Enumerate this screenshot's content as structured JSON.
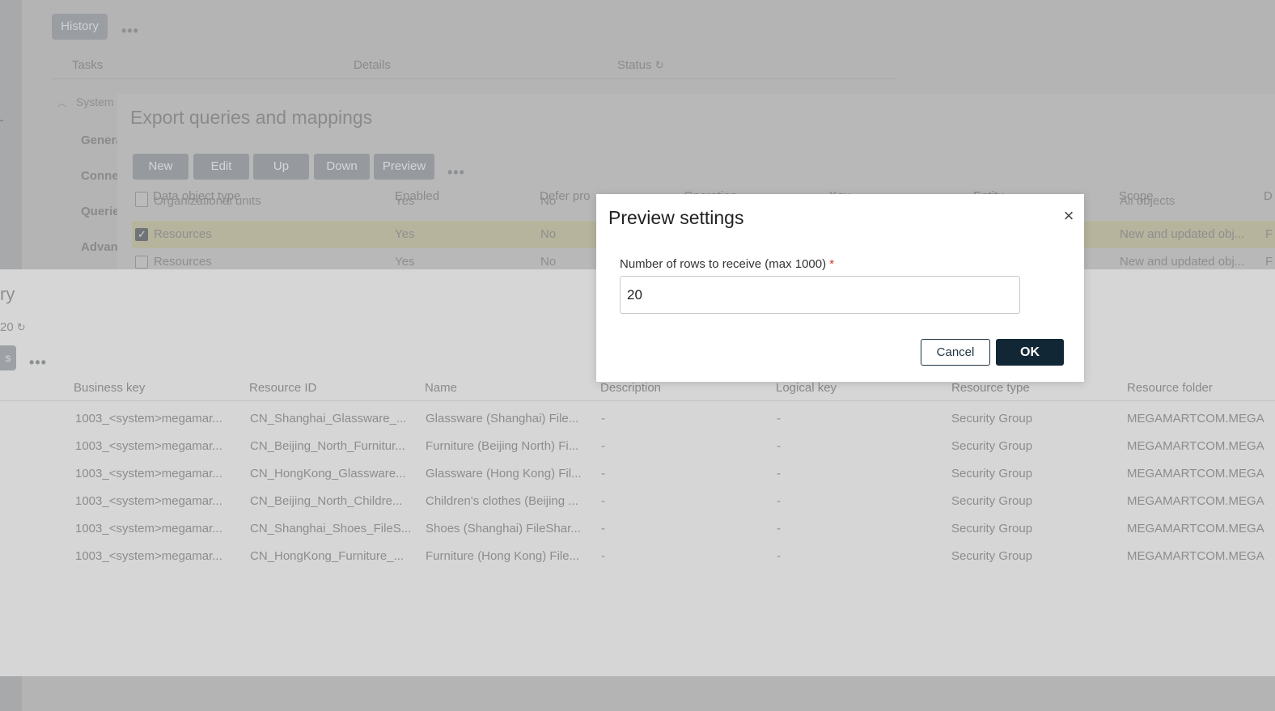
{
  "base": {
    "history_button": "History",
    "headers": {
      "tasks": "Tasks",
      "details": "Details",
      "status": "Status"
    },
    "section_label": "System",
    "sidebar_items": [
      "General",
      "Connection",
      "Queries",
      "Advanced"
    ]
  },
  "export_panel": {
    "title": "Export queries and mappings",
    "toolbar": [
      "New",
      "Edit",
      "Up",
      "Down",
      "Preview"
    ],
    "columns": [
      "Data object type",
      "Enabled",
      "Defer pro",
      "",
      "Operation",
      "Key",
      "Entity",
      "Scope",
      "D"
    ],
    "partial_row": {
      "type": "Organizational units",
      "enabled": "Yes",
      "defer": "No",
      "scope": "All objects"
    },
    "rows": [
      {
        "type": "Resources",
        "enabled": "Yes",
        "defer": "No",
        "scope": "New and updated obj...",
        "tail": "F",
        "checked": true
      },
      {
        "type": "Resources",
        "enabled": "Yes",
        "defer": "No",
        "scope": "New and updated obj...",
        "tail": "F",
        "checked": false
      }
    ]
  },
  "preview_panel": {
    "title": "ry",
    "count": "20",
    "action_button": "s",
    "columns": [
      "Business key",
      "Resource ID",
      "Name",
      "Description",
      "Logical key",
      "Resource type",
      "Resource folder"
    ],
    "rows": [
      [
        "1003_<system>megamar...",
        "CN_Shanghai_Glassware_...",
        "Glassware (Shanghai) File...",
        "-",
        "-",
        "Security Group",
        "MEGAMARTCOM.MEGA"
      ],
      [
        "1003_<system>megamar...",
        "CN_Beijing_North_Furnitur...",
        "Furniture (Beijing North) Fi...",
        "-",
        "-",
        "Security Group",
        "MEGAMARTCOM.MEGA"
      ],
      [
        "1003_<system>megamar...",
        "CN_HongKong_Glassware...",
        "Glassware (Hong Kong) Fil...",
        "-",
        "-",
        "Security Group",
        "MEGAMARTCOM.MEGA"
      ],
      [
        "1003_<system>megamar...",
        "CN_Beijing_North_Childre...",
        "Children's clothes (Beijing ...",
        "-",
        "-",
        "Security Group",
        "MEGAMARTCOM.MEGA"
      ],
      [
        "1003_<system>megamar...",
        "CN_Shanghai_Shoes_FileS...",
        "Shoes (Shanghai) FileShar...",
        "-",
        "-",
        "Security Group",
        "MEGAMARTCOM.MEGA"
      ],
      [
        "1003_<system>megamar...",
        "CN_HongKong_Furniture_...",
        "Furniture (Hong Kong) File...",
        "-",
        "-",
        "Security Group",
        "MEGAMARTCOM.MEGA"
      ]
    ]
  },
  "modal": {
    "title": "Preview settings",
    "close_icon": "close-icon",
    "field_label": "Number of rows to receive (max 1000)",
    "required_mark": "*",
    "rows_value": "20",
    "cancel_label": "Cancel",
    "ok_label": "OK"
  },
  "colors": {
    "primary_dark": "#122735",
    "required": "#d0342c",
    "selected_row": "#b6b49d"
  }
}
